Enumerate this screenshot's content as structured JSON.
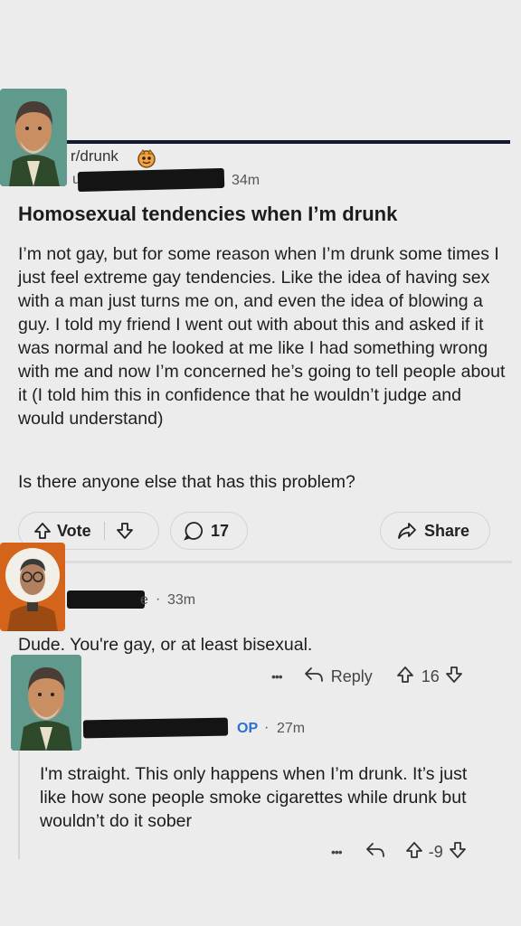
{
  "post": {
    "subreddit": "r/drunk",
    "author_initial": "u",
    "time": "34m",
    "title": "Homosexual tendencies when I’m drunk",
    "body": "I’m not gay, but for some reason when I’m drunk some times I just feel extreme gay tendencies. Like the idea of having sex with a man just turns me on, and even the idea of blowing a guy. I told my friend I went out with about this and asked if it was normal and he looked at me like I had something wrong with me and now I’m concerned he’s going to tell people about it (I told him this in confidence that he wouldn’t judge and would understand)",
    "question": "Is there anyone else that has this problem?",
    "vote_label": "Vote",
    "comment_count": "17",
    "share_label": "Share"
  },
  "comment1": {
    "author_tail": "e",
    "time": "33m",
    "text": "Dude. You're gay, or at least bisexual.",
    "more": "•••",
    "reply_label": "Reply",
    "score": "16"
  },
  "comment2": {
    "op_badge": "OP",
    "time": "27m",
    "text": "I'm straight. This only happens when I’m drunk. It’s just like how sone people smoke cigarettes while drunk but wouldn’t do it sober",
    "more": "•••",
    "score": "-9"
  },
  "icons": [
    "snoo-icon",
    "upvote-icon",
    "downvote-icon",
    "comment-icon",
    "share-icon",
    "reply-icon",
    "more-icon"
  ]
}
